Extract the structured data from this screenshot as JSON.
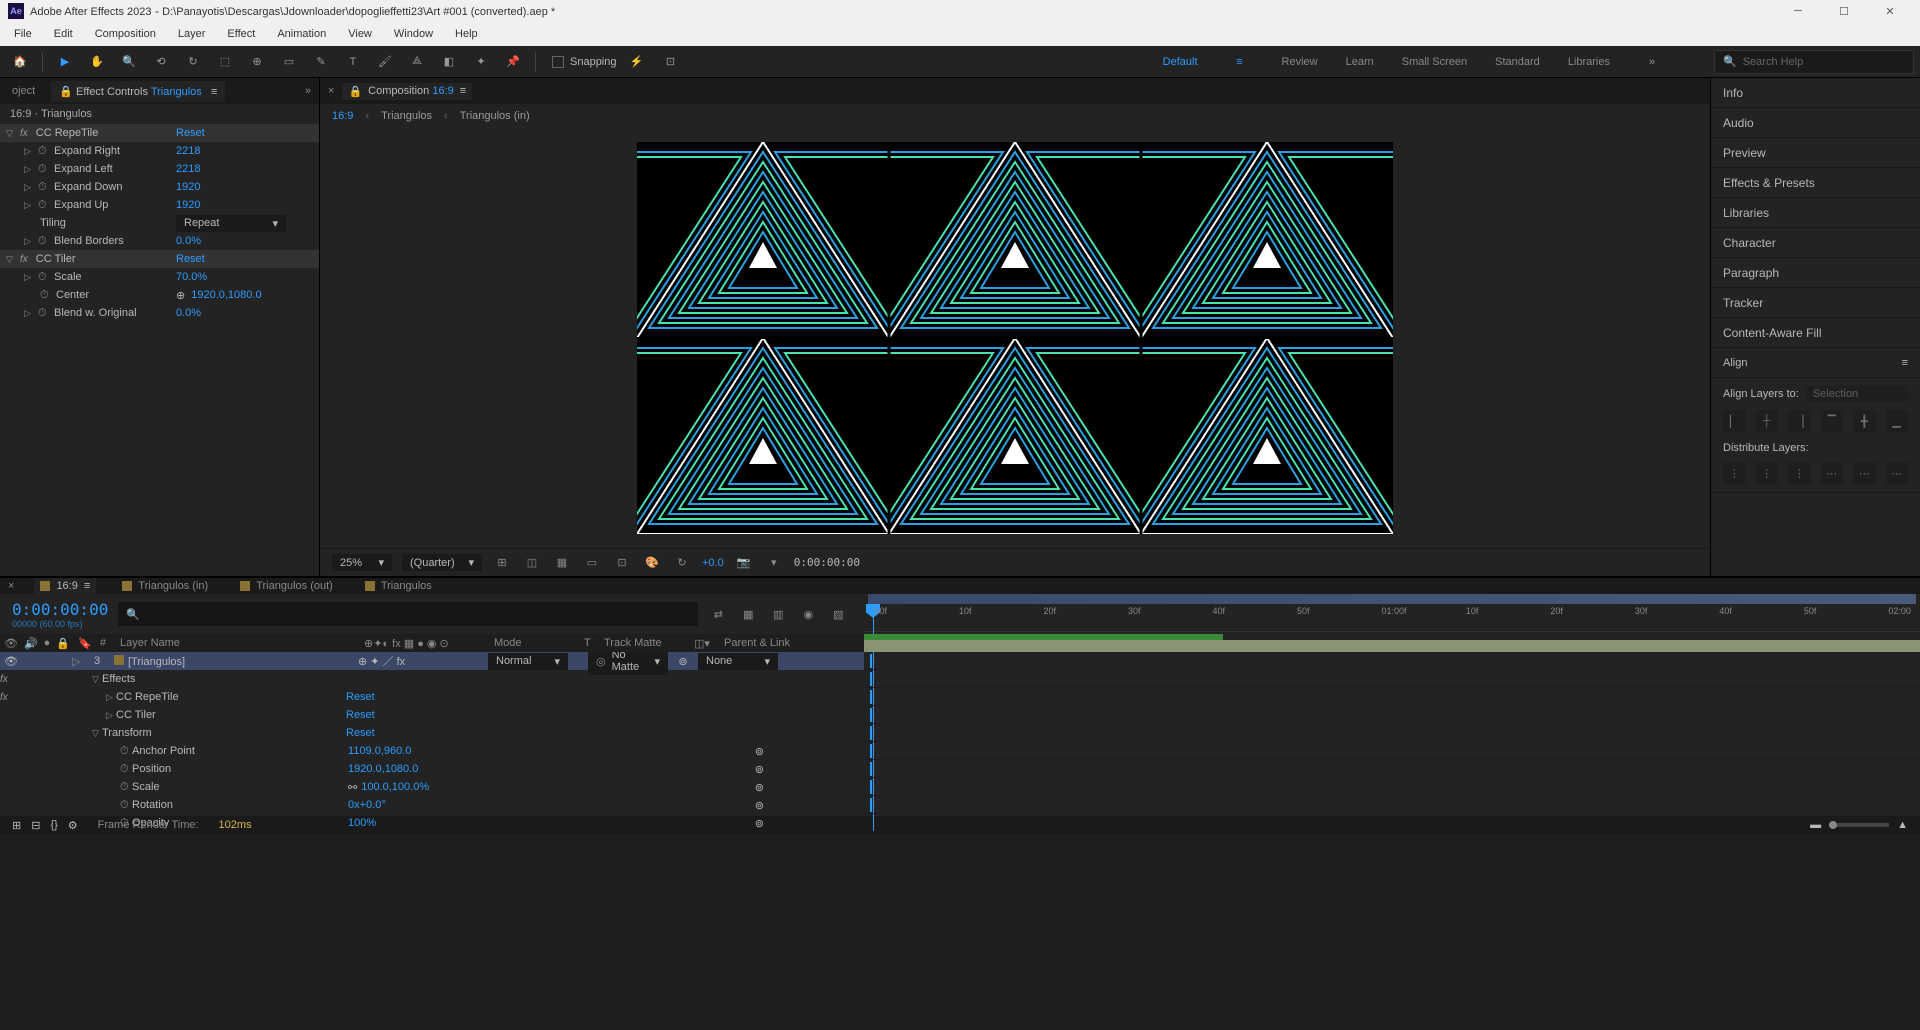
{
  "titlebar": {
    "app": "Adobe After Effects 2023",
    "file": "D:\\Panayotis\\Descargas\\Jdownloader\\dopoglieffetti23\\Art #001 (converted).aep *"
  },
  "menu": [
    "File",
    "Edit",
    "Composition",
    "Layer",
    "Effect",
    "Animation",
    "View",
    "Window",
    "Help"
  ],
  "snapping": "Snapping",
  "workspaces": [
    "Default",
    "Review",
    "Learn",
    "Small Screen",
    "Standard",
    "Libraries"
  ],
  "workspace_active": "Default",
  "search_help": "Search Help",
  "project_tab": "oject",
  "ec_tab_prefix": "Effect Controls ",
  "ec_tab_layer": "Triangulos",
  "ec_layer_path": "16:9 · Triangulos",
  "effects": {
    "repetile": {
      "name": "CC RepeTile",
      "reset": "Reset",
      "props": [
        {
          "name": "Expand Right",
          "val": "2218"
        },
        {
          "name": "Expand Left",
          "val": "2218"
        },
        {
          "name": "Expand Down",
          "val": "1920"
        },
        {
          "name": "Expand Up",
          "val": "1920"
        }
      ],
      "tiling_label": "Tiling",
      "tiling_val": "Repeat",
      "blend_label": "Blend Borders",
      "blend_val": "0.0%"
    },
    "tiler": {
      "name": "CC Tiler",
      "reset": "Reset",
      "scale_label": "Scale",
      "scale_val": "70.0%",
      "center_label": "Center",
      "center_val": "1920.0,1080.0",
      "blend_label": "Blend w. Original",
      "blend_val": "0.0%"
    }
  },
  "comp_panel_label": "Composition ",
  "comp_panel_name": "16:9",
  "breadcrumb": [
    "16:9",
    "Triangulos",
    "Triangulos (in)"
  ],
  "viewer": {
    "zoom": "25%",
    "res": "(Quarter)",
    "exposure": "+0.0",
    "time": "0:00:00:00"
  },
  "right_panels": [
    "Info",
    "Audio",
    "Preview",
    "Effects & Presets",
    "Libraries",
    "Character",
    "Paragraph",
    "Tracker",
    "Content-Aware Fill"
  ],
  "align": {
    "title": "Align",
    "align_to": "Align Layers to:",
    "selection": "Selection",
    "distribute": "Distribute Layers:"
  },
  "timeline": {
    "tabs": [
      {
        "name": "16:9",
        "active": true
      },
      {
        "name": "Triangulos (in)"
      },
      {
        "name": "Triangulos (out)"
      },
      {
        "name": "Triangulos"
      }
    ],
    "time": "0:00:00:00",
    "sub": "00000 (60.00 fps)",
    "ticks": [
      "00f",
      "10f",
      "20f",
      "30f",
      "40f",
      "50f",
      "01:00f",
      "10f",
      "20f",
      "30f",
      "40f",
      "50f",
      "02:00"
    ],
    "col_headers": {
      "num": "#",
      "layer_name": "Layer Name",
      "mode": "Mode",
      "t": "T",
      "track_matte": "Track Matte",
      "parent": "Parent & Link"
    },
    "layer": {
      "num": "3",
      "name": "[Triangulos]",
      "mode": "Normal",
      "matte": "No Matte",
      "parent": "None"
    },
    "layer_tree": {
      "effects": "Effects",
      "repetile": "CC RepeTile",
      "repetile_reset": "Reset",
      "tiler": "CC Tiler",
      "tiler_reset": "Reset",
      "transform": "Transform",
      "transform_reset": "Reset",
      "anchor": "Anchor Point",
      "anchor_v": "1109.0,960.0",
      "position": "Position",
      "position_v": "1920.0,1080.0",
      "scale": "Scale",
      "scale_v": "100.0,100.0%",
      "rotation": "Rotation",
      "rotation_v": "0x+0.0°",
      "opacity": "Opacity",
      "opacity_v": "100%"
    }
  },
  "footer": {
    "frt": "Frame Render Time:",
    "frt_val": "102ms"
  }
}
